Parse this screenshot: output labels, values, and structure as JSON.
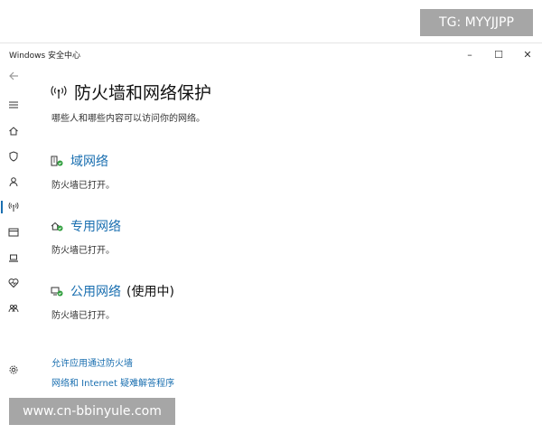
{
  "watermarks": {
    "top": "TG: MYYJJPP",
    "bottom": "www.cn-bbinyule.com"
  },
  "window": {
    "title": "Windows 安全中心",
    "controls": {
      "minimize": "–",
      "maximize": "☐",
      "close": "✕"
    }
  },
  "rail": {
    "items": [
      {
        "icon": "back-arrow-icon"
      },
      {
        "icon": "hamburger-menu-icon"
      },
      {
        "icon": "home-icon"
      },
      {
        "icon": "shield-icon"
      },
      {
        "icon": "person-icon"
      },
      {
        "icon": "wifi-antenna-icon",
        "active": true
      },
      {
        "icon": "app-browser-icon"
      },
      {
        "icon": "laptop-icon"
      },
      {
        "icon": "heart-pulse-icon"
      },
      {
        "icon": "family-icon"
      },
      {
        "icon": "settings-gear-icon"
      }
    ],
    "accent": "#1a6fb0"
  },
  "page": {
    "title": "防火墙和网络保护",
    "subtitle": "哪些人和哪些内容可以访问你的网络。",
    "networks": [
      {
        "name": "域网络",
        "suffix": "",
        "status": "防火墙已打开。",
        "icon": "domain-network-icon"
      },
      {
        "name": "专用网络",
        "suffix": "",
        "status": "防火墙已打开。",
        "icon": "private-network-icon"
      },
      {
        "name": "公用网络",
        "suffix": "(使用中)",
        "status": "防火墙已打开。",
        "icon": "public-network-icon"
      }
    ],
    "links": [
      "允许应用通过防火墙",
      "网络和 Internet 疑难解答程序"
    ]
  },
  "colors": {
    "link": "#1a6fb0",
    "status_ok": "#2e9e3c"
  }
}
